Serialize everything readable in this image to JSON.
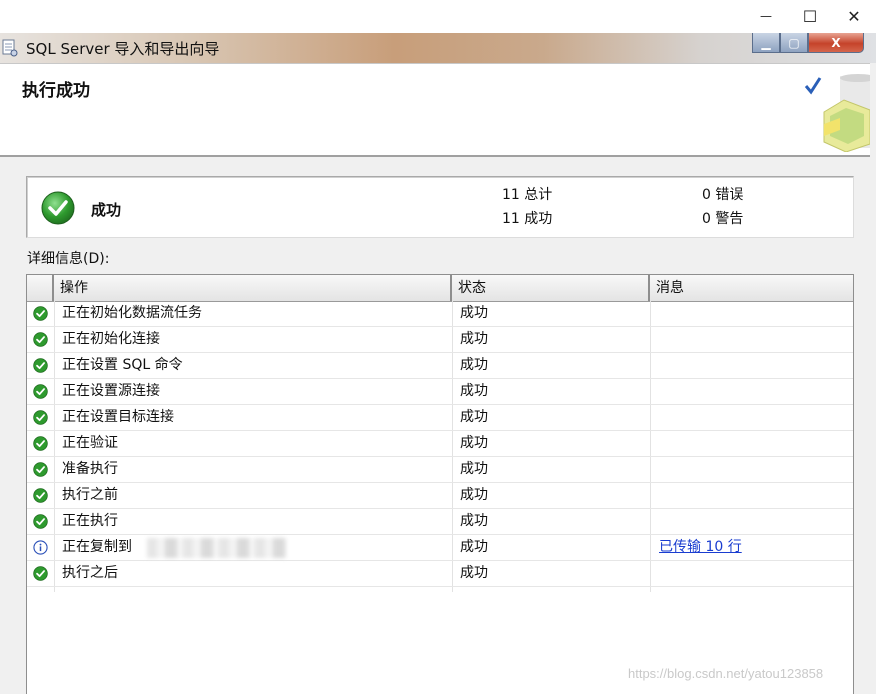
{
  "window": {
    "title": "SQL Server 导入和导出向导",
    "caption_minimize": "—",
    "caption_maximize": "☐",
    "caption_close": "✕",
    "aero_minimize": "▁",
    "aero_maximize": "▢",
    "aero_close": "X"
  },
  "header": {
    "title": "执行成功"
  },
  "summary": {
    "status": "成功",
    "total": "11 总计",
    "success": "11 成功",
    "errors": "0 错误",
    "warnings": "0 警告"
  },
  "details": {
    "label": "详细信息(D):",
    "columns": [
      "操作",
      "状态",
      "消息"
    ],
    "rows": [
      {
        "icon": "success-icon",
        "action": "正在初始化数据流任务",
        "status": "成功",
        "message": ""
      },
      {
        "icon": "success-icon",
        "action": "正在初始化连接",
        "status": "成功",
        "message": ""
      },
      {
        "icon": "success-icon",
        "action": "正在设置 SQL 命令",
        "status": "成功",
        "message": ""
      },
      {
        "icon": "success-icon",
        "action": "正在设置源连接",
        "status": "成功",
        "message": ""
      },
      {
        "icon": "success-icon",
        "action": "正在设置目标连接",
        "status": "成功",
        "message": ""
      },
      {
        "icon": "success-icon",
        "action": "正在验证",
        "status": "成功",
        "message": ""
      },
      {
        "icon": "success-icon",
        "action": "准备执行",
        "status": "成功",
        "message": ""
      },
      {
        "icon": "success-icon",
        "action": "执行之前",
        "status": "成功",
        "message": ""
      },
      {
        "icon": "success-icon",
        "action": "正在执行",
        "status": "成功",
        "message": ""
      },
      {
        "icon": "info-icon",
        "action": "正在复制到",
        "status": "成功",
        "message": "已传输 10 行"
      },
      {
        "icon": "success-icon",
        "action": "执行之后",
        "status": "成功",
        "message": ""
      }
    ]
  },
  "watermark": "https://blog.csdn.net/yatou123858",
  "colors": {
    "success_green": "#2e9a2e",
    "info_blue": "#2a50b8",
    "link_blue": "#1a3dd0"
  }
}
